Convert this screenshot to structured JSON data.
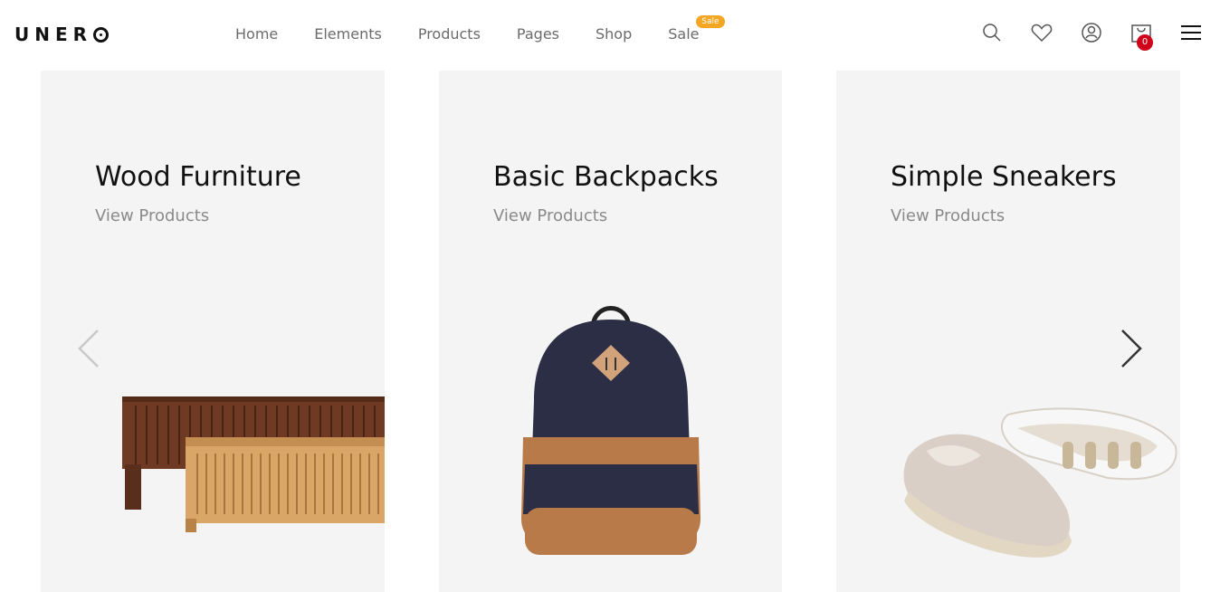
{
  "brand": {
    "logo_text_a": "UNER",
    "logo_text_b": ""
  },
  "nav": {
    "items": [
      {
        "label": "Home"
      },
      {
        "label": "Elements"
      },
      {
        "label": "Products"
      },
      {
        "label": "Pages"
      },
      {
        "label": "Shop"
      },
      {
        "label": "Sale",
        "badge": "Sale"
      }
    ]
  },
  "header_icons": {
    "search": "search-icon",
    "wishlist": "heart-icon",
    "account": "user-icon",
    "cart": "cart-icon",
    "cart_count": "0",
    "menu": "hamburger-menu-icon"
  },
  "carousel": {
    "cards": [
      {
        "title": "Wood Furniture",
        "link": "View Products",
        "image": "wood-furniture-image"
      },
      {
        "title": "Basic Backpacks",
        "link": "View Products",
        "image": "backpack-image"
      },
      {
        "title": "Simple Sneakers",
        "link": "View Products",
        "image": "sneakers-image"
      }
    ]
  },
  "colors": {
    "accent": "#f5a623",
    "badge_red": "#d0021b",
    "card_bg": "#f4f4f4"
  }
}
